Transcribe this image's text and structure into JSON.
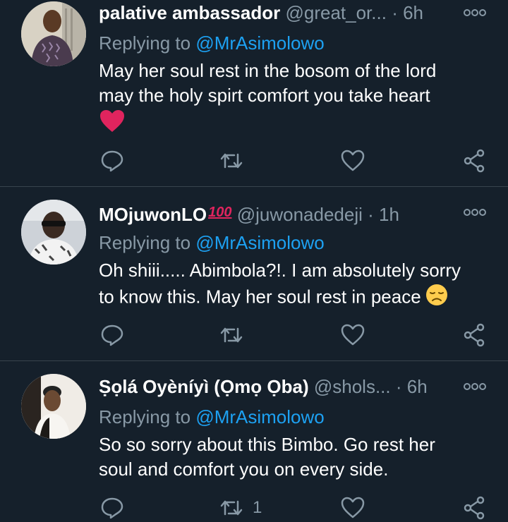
{
  "tweets": [
    {
      "display_name": "palative ambassador",
      "handle": "@great_or...",
      "separator": "·",
      "time": "6h",
      "reply_prefix": "Replying to",
      "reply_to": "@MrAsimolowo",
      "body": [
        "May her soul rest in the bosom of the lord",
        "may the holy spirt comfort you take heart"
      ],
      "trailing_emoji": "red-heart",
      "retweet_count": ""
    },
    {
      "display_name": "MOjuwonLO",
      "name_badge": "100",
      "handle": "@juwonadedeji",
      "separator": "·",
      "time": "1h",
      "reply_prefix": "Replying to",
      "reply_to": "@MrAsimolowo",
      "body": [
        "Oh shiii..... Abimbola?!. I am absolutely sorry",
        "to know this. May her soul rest in peace"
      ],
      "trailing_emoji": "disappointed-face",
      "retweet_count": ""
    },
    {
      "display_name": "Ṣọlá Oyèníyì (Ọmọ Ọba)",
      "handle": "@shols...",
      "separator": "·",
      "time": "6h",
      "reply_prefix": "Replying to",
      "reply_to": "@MrAsimolowo",
      "body": [
        "So so sorry about this Bimbo. Go rest her",
        "soul and comfort you on every side."
      ],
      "retweet_count": "1"
    }
  ],
  "icons": {
    "reply": "reply-icon",
    "retweet": "retweet-icon",
    "like": "like-icon",
    "share": "share-icon",
    "more": "more-icon"
  },
  "colors": {
    "background": "#15202b",
    "text": "#ffffff",
    "secondary": "#8899a6",
    "mention": "#1da1f2",
    "divider": "#38444d",
    "heart": "#e0245e"
  }
}
